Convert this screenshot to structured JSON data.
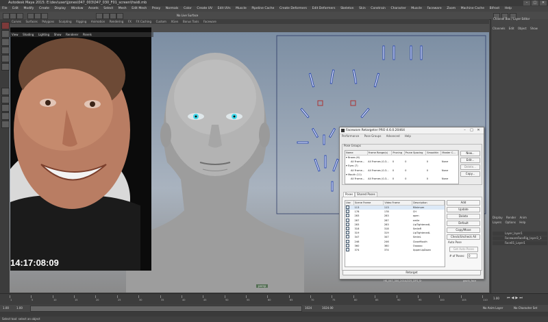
{
  "app": {
    "title": "Autodesk Maya 2015: E:\\dev\\user\\jjones\\047_003\\047_030_F01_screen\\fraidi.mb",
    "window_buttons": [
      "–",
      "□",
      "✕"
    ]
  },
  "menubar": [
    "File",
    "Edit",
    "Modify",
    "Create",
    "Display",
    "Window",
    "Assets",
    "Select",
    "Mesh",
    "Edit Mesh",
    "Proxy",
    "Normals",
    "Color",
    "Create UV",
    "Edit UVs",
    "Muscle",
    "Pipeline Cache",
    "Create Deformers",
    "Edit Deformers",
    "Skeleton",
    "Skin",
    "Constrain",
    "Character",
    "Muscle",
    "Faceware",
    "Zoom",
    "Machine Cache",
    "Bifrost",
    "Help"
  ],
  "statusline": {
    "label": "No Live Surface"
  },
  "shelf_tabs": [
    "Curves",
    "Surfaces",
    "Polygons",
    "Sculpting",
    "Rigging",
    "Animation",
    "Rendering",
    "FX",
    "FX Caching",
    "Custom",
    "XGen",
    "Bonus Tools",
    "Faceware"
  ],
  "viewport_menu": [
    "View",
    "Shading",
    "Lighting",
    "Show",
    "Renderer",
    "Panels"
  ],
  "video": {
    "timecode": "14:17:08:09"
  },
  "viewport_label": "persp",
  "right_panel": {
    "header": "Channel Box / Layer Editor",
    "tabs": [
      "Channels",
      "Edit",
      "Object",
      "Show"
    ],
    "layer_tabs": [
      "Display",
      "Render",
      "Anim"
    ],
    "layer_menu": [
      "Layers",
      "Options",
      "Help"
    ],
    "layers": [
      "Layer_layer1",
      "FacewareFaceRig_layer3_1",
      "Face01_Layer1"
    ]
  },
  "dialog": {
    "title": "Faceware Retargeter PRO 4.6.0.20464",
    "menu": [
      "Performance",
      "Pose Groups",
      "Advanced",
      "Help"
    ],
    "pose_groups_title": "Pose Groups",
    "pg_columns": [
      "Name",
      "Frame Range(s)",
      "Pruning",
      "Prune Spacing",
      "Smoothin",
      "Master C..."
    ],
    "pose_groups": [
      {
        "name": "Brows (6)",
        "range": "",
        "pruning": "",
        "spacing": "",
        "smooth": "",
        "master": ""
      },
      {
        "name": "All Frame...",
        "range": "All Frames (0-3...",
        "pruning": "0",
        "spacing": "0",
        "smooth": "0",
        "master": "None"
      },
      {
        "name": "Eyes (7)",
        "range": "",
        "pruning": "",
        "spacing": "",
        "smooth": "",
        "master": ""
      },
      {
        "name": "All Frame...",
        "range": "All Frames (0-3...",
        "pruning": "0",
        "spacing": "0",
        "smooth": "0",
        "master": "None"
      },
      {
        "name": "Mouth (11)",
        "range": "",
        "pruning": "",
        "spacing": "",
        "smooth": "",
        "master": ""
      },
      {
        "name": "All Frame...",
        "range": "All Frames (0-3...",
        "pruning": "0",
        "spacing": "0",
        "smooth": "0",
        "master": "None"
      }
    ],
    "pg_buttons": [
      "New...",
      "Edit...",
      "Delete...",
      "Copy..."
    ],
    "tabs": [
      "Poses",
      "Shared Poses"
    ],
    "pose_columns": [
      "Use",
      "Scene Frame",
      "Video Frame",
      "Description"
    ],
    "poses": [
      {
        "scene": "113",
        "video": "113",
        "desc": "Minimum"
      },
      {
        "scene": "178",
        "video": "178",
        "desc": "CH"
      },
      {
        "scene": "283",
        "video": "283",
        "desc": "open"
      },
      {
        "scene": "287",
        "video": "287",
        "desc": "smile"
      },
      {
        "scene": "283",
        "video": "283",
        "desc": "LipTightenedL"
      },
      {
        "scene": "318",
        "video": "318",
        "desc": "SmileR"
      },
      {
        "scene": "319",
        "video": "319",
        "desc": "LipTightenedL"
      },
      {
        "scene": "347",
        "video": "347",
        "desc": "SmileL"
      },
      {
        "scene": "246",
        "video": "246",
        "desc": "CloseMouth"
      },
      {
        "scene": "360",
        "video": "360",
        "desc": "Oooooo"
      },
      {
        "scene": "374",
        "video": "374",
        "desc": "UpperLipDown"
      }
    ],
    "pose_buttons": [
      "Add",
      "Update",
      "Delete",
      "Default",
      "Copy/Move",
      "Check/Uncheck All"
    ],
    "auto_pose_label": "Auto Pose",
    "auto_pose_button": "Get Auto Poses",
    "num_poses_label": "# of Poses:",
    "num_poses_value": "0",
    "retarget_button": "Retarget",
    "status_left": "HK_047_300_2014/225_DFS_Sr",
    "status_right": "gwnh_face"
  },
  "timeline": {
    "ticks": [
      "1",
      "5",
      "10",
      "15",
      "20",
      "25",
      "30",
      "35",
      "40",
      "45",
      "50",
      "55",
      "60",
      "65",
      "70",
      "75",
      "80",
      "85",
      "90",
      "95",
      "100",
      "105",
      "110"
    ],
    "current": "1.00"
  },
  "rangebar": {
    "start": "1.00",
    "end": "1.00",
    "range_end": "1024",
    "total": "1024.00",
    "anim_layer": "No Anim Layer",
    "char_set": "No Character Set"
  },
  "helpline": {
    "text": "Select tool: select an object"
  },
  "colors": {
    "accent": "#3aa0e0",
    "dialog_bg": "#e9e9e9",
    "iris": "#4fe0f0"
  }
}
